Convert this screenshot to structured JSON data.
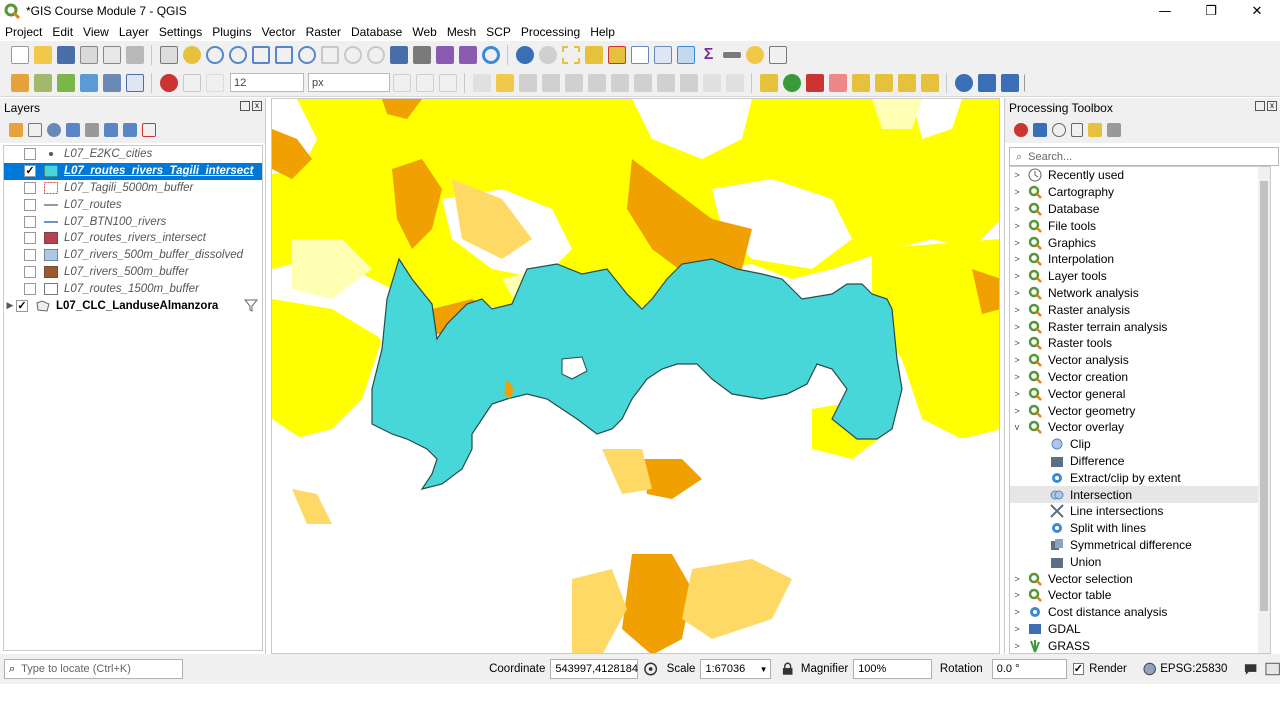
{
  "window": {
    "title": "*GIS Course Module 7 - QGIS",
    "min": "—",
    "restore": "❐",
    "close": "✕"
  },
  "menu": [
    "Project",
    "Edit",
    "View",
    "Layer",
    "Settings",
    "Plugins",
    "Vector",
    "Raster",
    "Database",
    "Web",
    "Mesh",
    "SCP",
    "Processing",
    "Help"
  ],
  "toolbar2": {
    "size_value": "12",
    "unit_value": "px"
  },
  "layers_panel": {
    "title": "Layers",
    "items": [
      {
        "name": "L07_E2KC_cities",
        "checked": false,
        "symbol": "point"
      },
      {
        "name": "L07_routes_rivers_Tagili_intersect",
        "checked": true,
        "symbol": "fill-cyan"
      },
      {
        "name": "L07_Tagili_5000m_buffer",
        "checked": false,
        "symbol": "dashed-red"
      },
      {
        "name": "L07_routes",
        "checked": false,
        "symbol": "line-grey"
      },
      {
        "name": "L07_BTN100_rivers",
        "checked": false,
        "symbol": "line-blue"
      },
      {
        "name": "L07_routes_rivers_intersect",
        "checked": false,
        "symbol": "fill-red"
      },
      {
        "name": "L07_rivers_500m_buffer_dissolved",
        "checked": false,
        "symbol": "fill-lightblue"
      },
      {
        "name": "L07_rivers_500m_buffer",
        "checked": false,
        "symbol": "fill-brown"
      },
      {
        "name": "L07_routes_1500m_buffer",
        "checked": false,
        "symbol": "fill-white"
      },
      {
        "name": "L07_CLC_LanduseAlmanzora",
        "checked": true,
        "symbol": "group"
      }
    ]
  },
  "processing_toolbox": {
    "title": "Processing Toolbox",
    "search_placeholder": "Search...",
    "groups": [
      "Recently used",
      "Cartography",
      "Database",
      "File tools",
      "Graphics",
      "Interpolation",
      "Layer tools",
      "Network analysis",
      "Raster analysis",
      "Raster terrain analysis",
      "Raster tools",
      "Vector analysis",
      "Vector creation",
      "Vector general",
      "Vector geometry",
      "Vector overlay"
    ],
    "overlay_children": [
      "Clip",
      "Difference",
      "Extract/clip by extent",
      "Intersection",
      "Line intersections",
      "Split with lines",
      "Symmetrical difference",
      "Union"
    ],
    "after_groups": [
      "Vector selection",
      "Vector table",
      "Cost distance analysis",
      "GDAL",
      "GRASS"
    ],
    "highlighted": "Intersection"
  },
  "status": {
    "locate_placeholder": "Type to locate (Ctrl+K)",
    "coordinate_label": "Coordinate",
    "coordinate_value": "543997,4128184",
    "scale_label": "Scale",
    "scale_value": "1:67036",
    "magnifier_label": "Magnifier",
    "magnifier_value": "100%",
    "rotation_label": "Rotation",
    "rotation_value": "0.0 °",
    "render_label": "Render",
    "crs": "EPSG:25830"
  },
  "colors": {
    "accent": "#0078d7",
    "yellow": "#ffff00",
    "light_yellow": "#ffffb3",
    "orange": "#f0a000",
    "tan": "#ffd966",
    "cyan": "#47d7d9"
  }
}
